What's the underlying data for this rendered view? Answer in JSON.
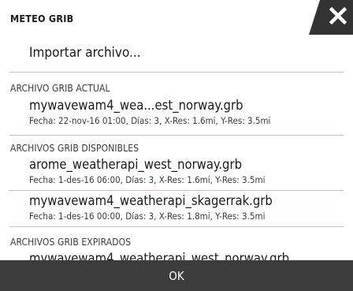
{
  "dialog": {
    "title": "METEO GRIB",
    "close_icon": "close-icon",
    "import_label": "Importar archivo..."
  },
  "sections": {
    "current": {
      "header": "ARCHIVO GRIB ACTUAL",
      "files": [
        {
          "name": "mywavewam4_wea...est_norway.grb",
          "meta": "Fecha: 22-nov-16 01:00, Días: 3, X-Res: 1.6mi, Y-Res: 3.5mi"
        }
      ]
    },
    "available": {
      "header": "ARCHIVOS GRIB DISPONIBLES",
      "files": [
        {
          "name": "arome_weatherapi_west_norway.grb",
          "meta": "Fecha: 1-des-16 06:00, Días: 3, X-Res: 1.6mi, Y-Res: 3.5mi"
        },
        {
          "name": "mywavewam4_weatherapi_skagerrak.grb",
          "meta": "Fecha: 1-des-16 00:00, Días: 3, X-Res: 1.8mi, Y-Res: 3.5mi"
        }
      ]
    },
    "expired": {
      "header": "ARCHIVOS GRIB EXPIRADOS",
      "files": [
        {
          "name": "mywavewam4_weatherapi_west_norway.grb"
        }
      ]
    }
  },
  "footer": {
    "ok_label": "OK"
  },
  "colors": {
    "close_tab": "#333333",
    "separator": "#e0b9bf",
    "footer": "#3c3c3c"
  }
}
